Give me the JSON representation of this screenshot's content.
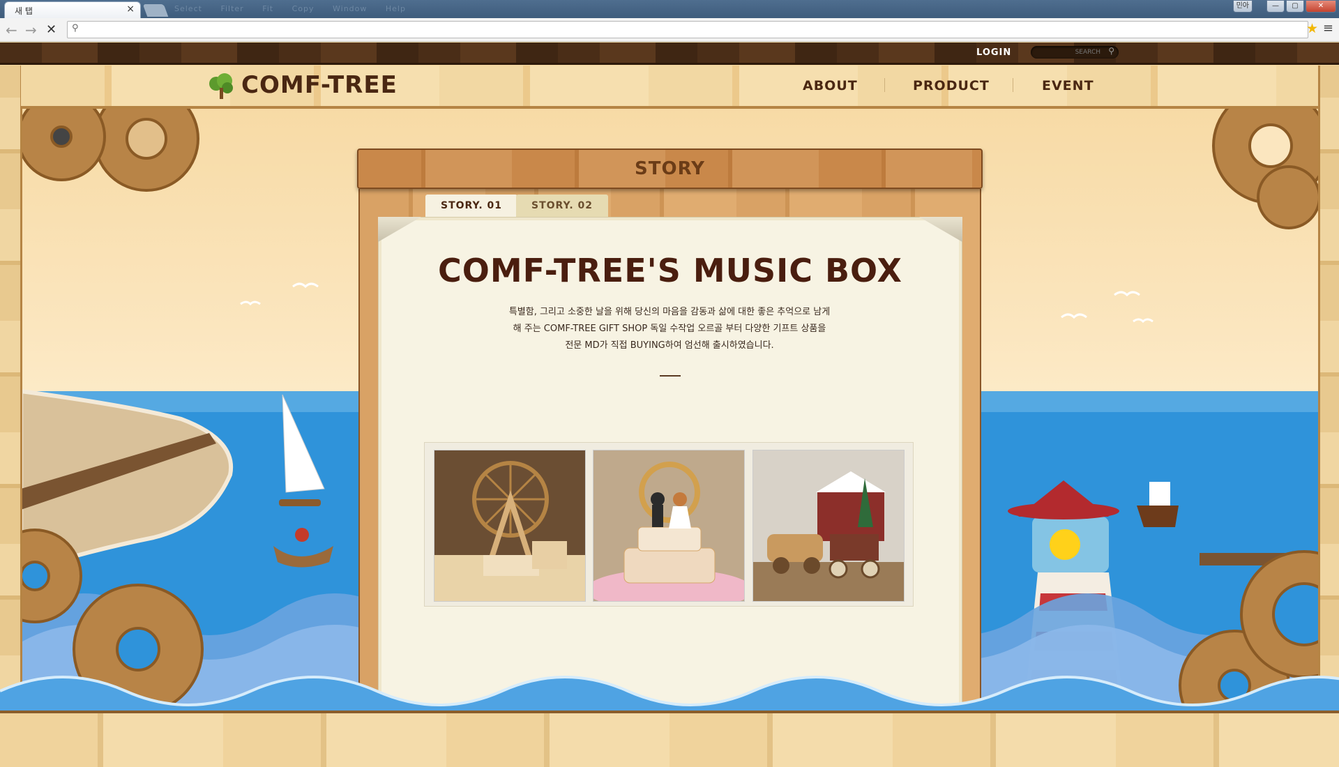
{
  "browser": {
    "tab_title": "새 탭",
    "tab_close": "×",
    "menu_items": [
      "Select",
      "Filter",
      "Fit",
      "Copy",
      "Window",
      "Help"
    ],
    "window_user": "민아",
    "window_minimize": "—",
    "window_maximize": "▢",
    "window_close": "✕",
    "back_glyph": "←",
    "forward_glyph": "→",
    "stop_glyph": "✕",
    "search_glyph": "⚲",
    "address_value": "",
    "bookmark_glyph": "★",
    "menu_glyph": "≡"
  },
  "site": {
    "top_bar": {
      "login_label": "LOGIN",
      "search_placeholder": "SEARCH",
      "search_glyph": "⚲"
    },
    "logo_text": "COMF-TREE",
    "nav": [
      "ABOUT",
      "PRODUCT",
      "EVENT"
    ]
  },
  "story": {
    "header": "STORY",
    "tabs": [
      "STORY. 01",
      "STORY. 02"
    ],
    "selected_tab": "STORY. 01",
    "title": "COMF-TREE'S MUSIC BOX",
    "description_lines": [
      "특별함, 그리고 소중한 날을 위해 당신의 마음을 감동과 삶에 대한 좋은 추억으로 남게",
      "해 주는 COMF-TREE GIFT SHOP 독일 수작업 오르골 부터 다양한 기프트 상품을",
      "전문 MD가 직접 BUYING하여 엄선해 출시하였습니다."
    ],
    "photos": [
      "ferris-wheel-music-box",
      "wedding-cake-music-box",
      "farm-train-music-box"
    ]
  },
  "colors": {
    "brand_brown": "#4a2712",
    "wood": "#d9a265",
    "sea": "#2b8ed6",
    "sky": "#fbe6bf",
    "paper": "#f7f3e3"
  }
}
